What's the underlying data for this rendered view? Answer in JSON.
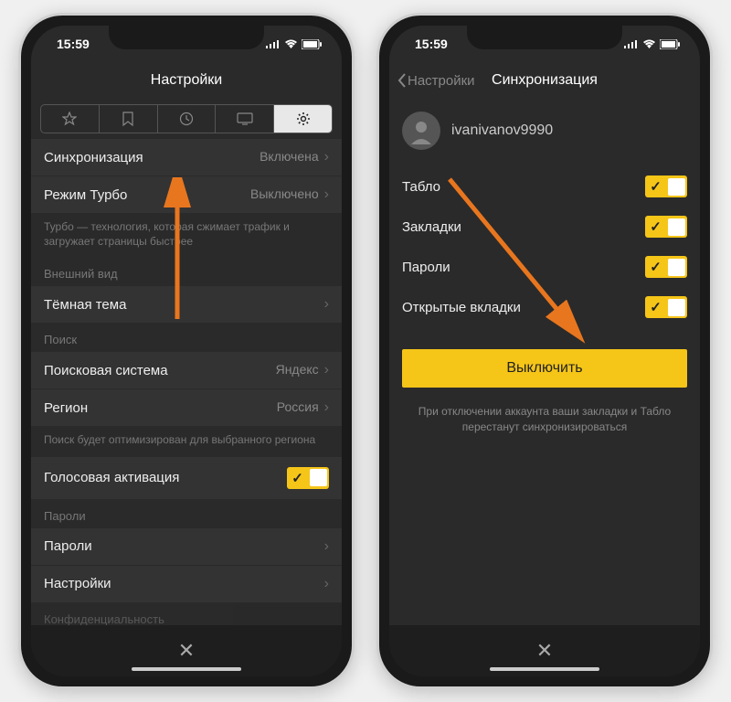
{
  "status": {
    "time": "15:59"
  },
  "left": {
    "title": "Настройки",
    "rows": {
      "sync": {
        "label": "Синхронизация",
        "value": "Включена"
      },
      "turbo": {
        "label": "Режим Турбо",
        "value": "Выключено"
      },
      "turbo_desc": "Турбо — технология, которая сжимает трафик и загружает страницы быстрее",
      "appearance_header": "Внешний вид",
      "dark": {
        "label": "Тёмная тема"
      },
      "search_header": "Поиск",
      "engine": {
        "label": "Поисковая система",
        "value": "Яндекс"
      },
      "region": {
        "label": "Регион",
        "value": "Россия"
      },
      "region_desc": "Поиск будет оптимизирован для выбранного региона",
      "voice": {
        "label": "Голосовая активация"
      },
      "pwd_header": "Пароли",
      "pwd": {
        "label": "Пароли"
      },
      "settings2": {
        "label": "Настройки"
      },
      "privacy": {
        "label": "Конфиденциальность"
      }
    }
  },
  "right": {
    "back": "Настройки",
    "title": "Синхронизация",
    "username": "ivanivanov9990",
    "items": {
      "tablo": "Табло",
      "bookmarks": "Закладки",
      "passwords": "Пароли",
      "tabs": "Открытые вкладки"
    },
    "button": "Выключить",
    "note": "При отключении аккаунта ваши закладки и Табло перестанут синхронизироваться"
  }
}
